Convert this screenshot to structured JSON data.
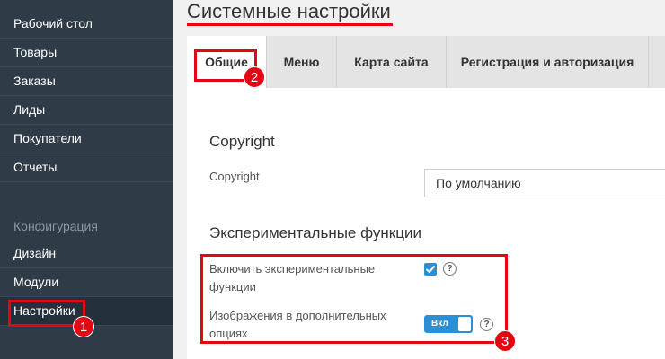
{
  "sidebar": {
    "items": [
      {
        "label": "Рабочий стол"
      },
      {
        "label": "Товары"
      },
      {
        "label": "Заказы"
      },
      {
        "label": "Лиды"
      },
      {
        "label": "Покупатели"
      },
      {
        "label": "Отчеты"
      }
    ],
    "section_label": "Конфигурация",
    "config_items": [
      {
        "label": "Дизайн"
      },
      {
        "label": "Модули"
      },
      {
        "label": "Настройки"
      }
    ]
  },
  "page": {
    "title": "Системные настройки"
  },
  "tabs": [
    {
      "label": "Общие",
      "active": true
    },
    {
      "label": "Меню"
    },
    {
      "label": "Карта сайта"
    },
    {
      "label": "Регистрация и авторизация"
    }
  ],
  "copyright_section": {
    "title": "Copyright",
    "field_label": "Copyright",
    "select_value": "По умолчанию"
  },
  "experimental_section": {
    "title": "Экспериментальные функции",
    "enable_label_line1": "Включить экспериментальные",
    "enable_label_line2": "функции",
    "enable_checked": true,
    "images_label_line1": "Изображения в дополнительных",
    "images_label_line2": "опциях",
    "toggle_label": "Вкл",
    "help_glyph": "?"
  },
  "annotations": {
    "badge1": "1",
    "badge2": "2",
    "badge3": "3"
  },
  "colors": {
    "accent_red": "#e30613",
    "sidebar_bg": "#2f3c48",
    "control_blue": "#2b8fd6"
  }
}
